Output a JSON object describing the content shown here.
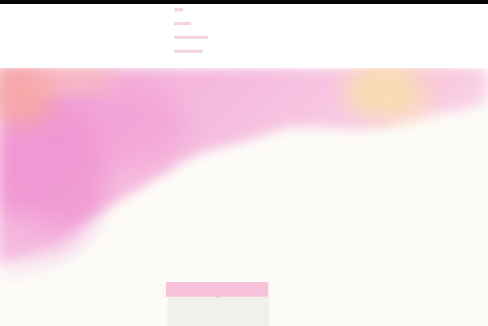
{
  "nav": {
    "items": [
      {
        "label": "",
        "icon": "nav-link-bar"
      },
      {
        "label": "",
        "icon": "nav-link-bar"
      },
      {
        "label": "",
        "icon": "nav-link-bar"
      },
      {
        "label": "",
        "icon": "nav-link-bar"
      }
    ]
  },
  "hero": {
    "style": "watercolor",
    "colors": {
      "pink": "#f39ad3",
      "magenta": "#ee86cf",
      "peach": "#f7b6a6",
      "yellow": "#fbe0b0",
      "cream": "#fcfbf7"
    }
  },
  "cta": {
    "tab_label": "",
    "tab_color": "#f8c3da",
    "panel_color": "#f1f0ec"
  }
}
